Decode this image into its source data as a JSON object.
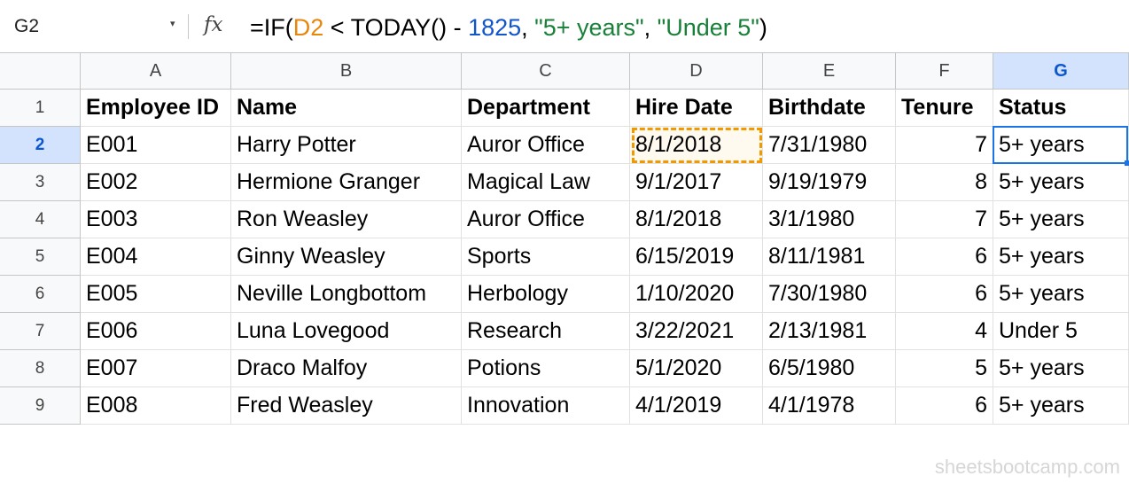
{
  "formula_bar": {
    "cell_ref": "G2",
    "fx_label": "fx",
    "formula_parts": [
      {
        "text": "=IF(",
        "kind": "plain"
      },
      {
        "text": "D2",
        "kind": "ref"
      },
      {
        "text": " < TODAY() - ",
        "kind": "plain"
      },
      {
        "text": "1825",
        "kind": "num"
      },
      {
        "text": ", ",
        "kind": "plain"
      },
      {
        "text": "\"5+ years\"",
        "kind": "str"
      },
      {
        "text": ", ",
        "kind": "plain"
      },
      {
        "text": "\"Under 5\"",
        "kind": "str"
      },
      {
        "text": ")",
        "kind": "plain"
      }
    ]
  },
  "colors": {
    "selection": "#1a73e8",
    "reference": "#f29900",
    "header_selected_bg": "#d3e3fd"
  },
  "grid": {
    "columns": [
      "A",
      "B",
      "C",
      "D",
      "E",
      "F",
      "G"
    ],
    "selected_column": "G",
    "selected_row": "2",
    "rows": [
      {
        "num": "1",
        "cells": [
          "Employee ID",
          "Name",
          "Department",
          "Hire Date",
          "Birthdate",
          "Tenure",
          "Status"
        ]
      },
      {
        "num": "2",
        "cells": [
          "E001",
          "Harry Potter",
          "Auror Office",
          "8/1/2018",
          "7/31/1980",
          "7",
          "5+ years"
        ]
      },
      {
        "num": "3",
        "cells": [
          "E002",
          "Hermione Granger",
          "Magical Law",
          "9/1/2017",
          "9/19/1979",
          "8",
          "5+ years"
        ]
      },
      {
        "num": "4",
        "cells": [
          "E003",
          "Ron Weasley",
          "Auror Office",
          "8/1/2018",
          "3/1/1980",
          "7",
          "5+ years"
        ]
      },
      {
        "num": "5",
        "cells": [
          "E004",
          "Ginny Weasley",
          "Sports",
          "6/15/2019",
          "8/11/1981",
          "6",
          "5+ years"
        ]
      },
      {
        "num": "6",
        "cells": [
          "E005",
          "Neville Longbottom",
          "Herbology",
          "1/10/2020",
          "7/30/1980",
          "6",
          "5+ years"
        ]
      },
      {
        "num": "7",
        "cells": [
          "E006",
          "Luna Lovegood",
          "Research",
          "3/22/2021",
          "2/13/1981",
          "4",
          "Under 5"
        ]
      },
      {
        "num": "8",
        "cells": [
          "E007",
          "Draco Malfoy",
          "Potions",
          "5/1/2020",
          "6/5/1980",
          "5",
          "5+ years"
        ]
      },
      {
        "num": "9",
        "cells": [
          "E008",
          "Fred Weasley",
          "Innovation",
          "4/1/2019",
          "4/1/1978",
          "6",
          "5+ years"
        ]
      }
    ]
  },
  "watermark": "sheetsbootcamp.com"
}
